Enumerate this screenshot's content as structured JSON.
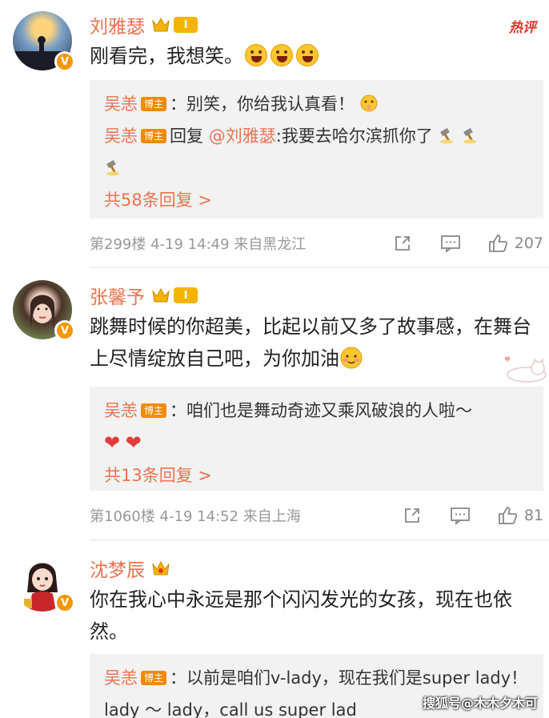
{
  "comments": [
    {
      "user": "刘雅瑟",
      "level": "I",
      "hot_tag": "热评",
      "text": "刚看完，我想笑。",
      "emoji_count": 3,
      "replies": [
        {
          "user": "吴恙",
          "badge": "博主",
          "sep": "：",
          "text": "别笑，你给我认真看！"
        },
        {
          "user": "吴恙",
          "badge": "博主",
          "reply_word": "回复",
          "mention": "@刘雅瑟",
          "text": ":我要去哈尔滨抓你了"
        }
      ],
      "more_replies": "共58条回复 >",
      "floor": "第299楼",
      "date": "4-19 14:49",
      "location": "来自黑龙江",
      "likes": "207"
    },
    {
      "user": "张馨予",
      "level": "I",
      "text": "跳舞时候的你超美，比起以前又多了故事感，在舞台上尽情绽放自己吧，为你加油",
      "replies": [
        {
          "user": "吴恙",
          "badge": "博主",
          "sep": "：",
          "text": "咱们也是舞动奇迹又乘风破浪的人啦～"
        }
      ],
      "more_replies": "共13条回复 >",
      "floor": "第1060楼",
      "date": "4-19 14:52",
      "location": "来自上海",
      "likes": "81"
    },
    {
      "user": "沈梦辰",
      "text": "你在我心中永远是那个闪闪发光的女孩，现在也依然。",
      "replies": [
        {
          "user": "吴恙",
          "badge": "博主",
          "sep": "：",
          "text": "以前是咱们v-lady，现在我们是super lady！ lady ～ lady，call us super lad"
        }
      ]
    }
  ],
  "watermark": "搜狐号@木木夕木可",
  "icons": [
    "share-icon",
    "comment-icon",
    "like-icon",
    "crown-icon",
    "verified-v-icon"
  ],
  "colors": {
    "name": "#eb7350",
    "hot": "#e4352b",
    "badge": "#f08a00",
    "reply_bg": "#f2f2f2",
    "meta": "#999999"
  }
}
